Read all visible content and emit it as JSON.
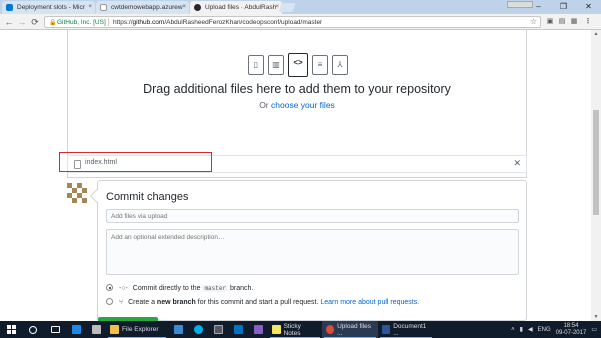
{
  "browser": {
    "tabs": [
      {
        "title": "Deployment slots - Micr",
        "favicon_color": "#0078d4",
        "active": false
      },
      {
        "title": "cwtdemowebapp.azurew",
        "favicon_color": "#ffffff",
        "active": false
      },
      {
        "title": "Upload files · AbdulRash",
        "favicon_color": "#24292e",
        "active": true
      }
    ],
    "close_glyph": "×",
    "window_controls": {
      "minimize": "–",
      "maximize": "❐",
      "close": "✕"
    },
    "nav": {
      "back": "←",
      "forward": "→",
      "reload": "⟳"
    },
    "security_label": "GitHub, Inc. [US]",
    "url_scheme": "https://",
    "url_host": "github.com",
    "url_path": "/AbdulRasheedFerozKhan/codeopsconf/upload/master",
    "bookmark_icon": "star-icon"
  },
  "upload": {
    "file_type_icons": [
      "file-icon",
      "graph-icon",
      "code-icon",
      "file-text-icon",
      "file-pdf-icon"
    ],
    "file_type_glyphs": [
      "▯",
      "▥",
      "<>",
      "≡",
      "⅄"
    ],
    "drop_title": "Drag additional files here to add them to your repository",
    "drop_or": "Or",
    "choose_link": "choose your files",
    "files": [
      {
        "name": "index.html"
      }
    ],
    "remove_glyph": "✕"
  },
  "commit": {
    "heading": "Commit changes",
    "summary_placeholder": "Add files via upload",
    "description_placeholder": "Add an optional extended description…",
    "option_direct_pre": "Commit directly to the",
    "option_direct_branch": "master",
    "option_direct_post": "branch.",
    "option_new_pre": "Create a",
    "option_new_bold": "new branch",
    "option_new_post": "for this commit and start a pull request.",
    "option_new_link": "Learn more about pull requests.",
    "selected_option": "direct"
  },
  "taskbar": {
    "apps": [
      {
        "label": "File Explorer",
        "color": "#f0c04a",
        "active": false
      },
      {
        "label": "Sticky Notes",
        "color": "#f7e463",
        "active": false
      },
      {
        "label": "Upload files ...",
        "color": "#dd4b39",
        "active": true
      },
      {
        "label": "Document1 ...",
        "color": "#2b579a",
        "active": false
      }
    ],
    "language": "ENG",
    "time": "18:54",
    "date": "09-07-2017"
  }
}
